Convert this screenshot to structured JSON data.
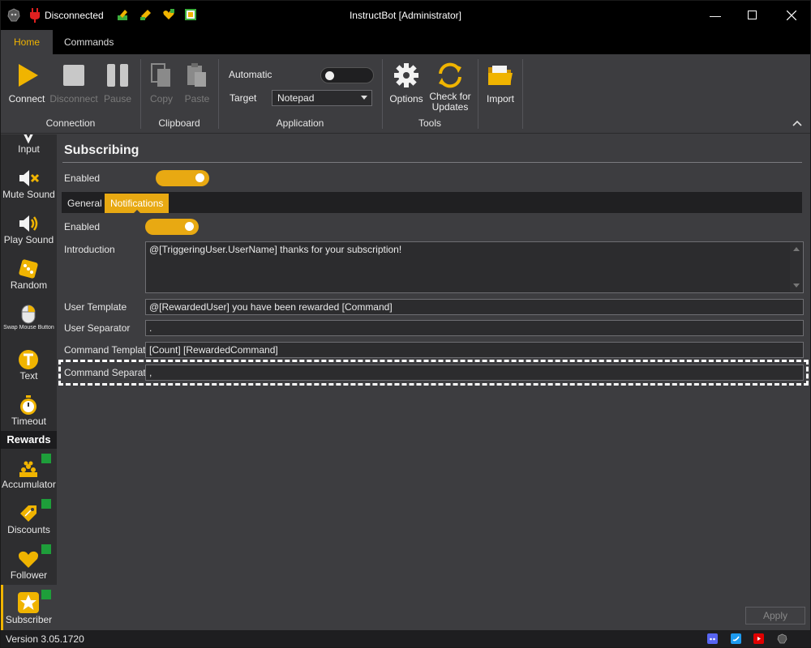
{
  "titlebar": {
    "connection_status": "Disconnected",
    "title": "InstructBot [Administrator]",
    "icons": [
      "app-logo-icon",
      "plug-icon",
      "wrench-money-icon",
      "ticket-icon",
      "heart-icon",
      "puzzle-icon"
    ]
  },
  "tabs": [
    {
      "label": "Home",
      "active": true
    },
    {
      "label": "Commands",
      "active": false
    }
  ],
  "ribbon": {
    "connect": "Connect",
    "disconnect": "Disconnect",
    "pause": "Pause",
    "copy": "Copy",
    "paste": "Paste",
    "automatic_label": "Automatic",
    "automatic_on": false,
    "target_label": "Target",
    "target_value": "Notepad",
    "options": "Options",
    "check_updates_line1": "Check for",
    "check_updates_line2": "Updates",
    "import": "Import",
    "groups": {
      "connection": "Connection",
      "clipboard": "Clipboard",
      "application": "Application",
      "tools": "Tools"
    }
  },
  "sidebar": {
    "items": [
      {
        "label": "Input",
        "icon": "input-icon"
      },
      {
        "label": "Mute Sound",
        "icon": "mute-sound-icon"
      },
      {
        "label": "Play Sound",
        "icon": "play-sound-icon"
      },
      {
        "label": "Random",
        "icon": "dice-icon"
      },
      {
        "label": "Swap Mouse Button",
        "icon": "mouse-icon"
      },
      {
        "label": "Text",
        "icon": "text-icon"
      },
      {
        "label": "Timeout",
        "icon": "stopwatch-icon"
      }
    ],
    "rewards_header": "Rewards",
    "reward_items": [
      {
        "label": "Accumulator",
        "icon": "accumulator-icon"
      },
      {
        "label": "Discounts",
        "icon": "discount-tag-icon"
      },
      {
        "label": "Follower",
        "icon": "heart-icon"
      },
      {
        "label": "Subscriber",
        "icon": "star-icon"
      }
    ]
  },
  "content": {
    "title": "Subscribing",
    "enabled_label": "Enabled",
    "enabled_on": true,
    "subtabs": [
      {
        "label": "General",
        "active": false
      },
      {
        "label": "Notifications",
        "active": true
      }
    ],
    "notifications": {
      "enabled_label": "Enabled",
      "enabled_on": true,
      "introduction_label": "Introduction",
      "introduction_value": "@[TriggeringUser.UserName] thanks for your subscription!",
      "user_template_label": "User Template",
      "user_template_value": "@[RewardedUser] you have been rewarded [Command]",
      "user_separator_label": "User Separator",
      "user_separator_value": ".",
      "command_template_label": "Command Template",
      "command_template_value": "[Count] [RewardedCommand]",
      "command_separator_label": "Command Separator",
      "command_separator_value": ","
    },
    "apply": "Apply"
  },
  "statusbar": {
    "version": "Version 3.05.1720",
    "icons": [
      "discord-icon",
      "twitter-icon",
      "youtube-icon",
      "app-logo-icon"
    ]
  },
  "colors": {
    "accent": "#e8a912",
    "background": "#3d3d40",
    "badge_green": "#1e9e3a"
  }
}
